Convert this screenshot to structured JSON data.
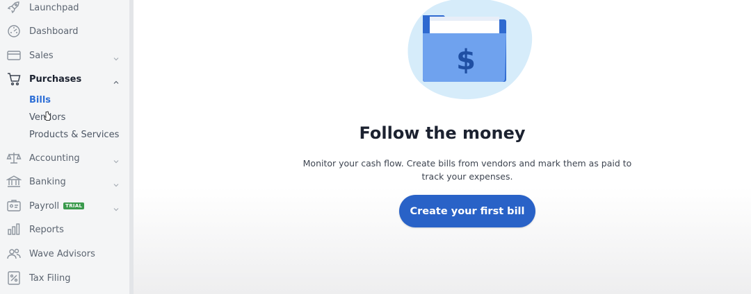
{
  "sidebar": {
    "items": [
      {
        "label": "Launchpad",
        "icon": "rocket-icon",
        "has_chevron": false
      },
      {
        "label": "Dashboard",
        "icon": "dashboard-icon",
        "has_chevron": false
      },
      {
        "label": "Sales",
        "icon": "credit-card-icon",
        "has_chevron": true
      },
      {
        "label": "Purchases",
        "icon": "cart-icon",
        "has_chevron": true,
        "expanded": true
      },
      {
        "label": "Accounting",
        "icon": "scales-icon",
        "has_chevron": true
      },
      {
        "label": "Banking",
        "icon": "bank-icon",
        "has_chevron": true
      },
      {
        "label": "Payroll",
        "icon": "payroll-icon",
        "has_chevron": true,
        "badge": "TRIAL"
      },
      {
        "label": "Reports",
        "icon": "bar-chart-icon",
        "has_chevron": false
      },
      {
        "label": "Wave Advisors",
        "icon": "people-icon",
        "has_chevron": false
      },
      {
        "label": "Tax Filing",
        "icon": "tax-document-icon",
        "has_chevron": false
      }
    ],
    "purchases_sub": [
      {
        "label": "Bills",
        "active": true
      },
      {
        "label": "Vendors",
        "active": false
      },
      {
        "label": "Products & Services",
        "active": false
      }
    ]
  },
  "main": {
    "illustration_icon": "money-folder-icon",
    "headline": "Follow the money",
    "description": "Monitor your cash flow. Create bills from vendors and mark them as paid to track your expenses.",
    "cta_label": "Create your first bill"
  },
  "colors": {
    "accent": "#2962c7",
    "active_sub": "#2e6fd6",
    "badge": "#3a9a4c",
    "sidebar_bg": "#f4f5f6"
  }
}
